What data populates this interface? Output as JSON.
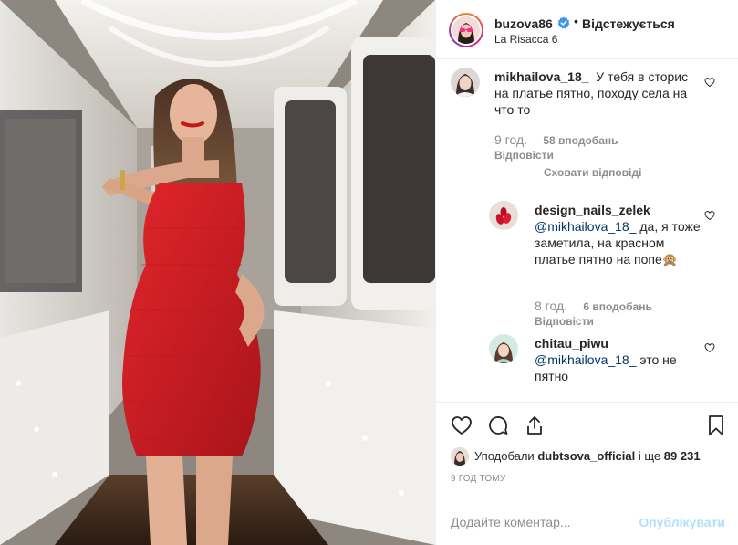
{
  "post": {
    "username": "buzova86",
    "separator": "•",
    "follow_status": "Відстежується",
    "location": "La Risacca 6"
  },
  "comments": [
    {
      "username": "mikhailova_18_",
      "text": "У тебя в сторис на платье пятно, походу села на что то",
      "time": "9 год.",
      "likes": "58 вподобань",
      "reply": "Відповісти",
      "hide_replies": "Сховати відповіді"
    },
    {
      "username": "design_nails_zelek",
      "mention": "@mikhailova_18_",
      "text": "да, я тоже заметила, на красном платье пятно на попе🙊",
      "time": "8 год.",
      "likes": "6 вподобань",
      "reply": "Відповісти"
    },
    {
      "username": "chitau_piwu",
      "mention": "@mikhailova_18_",
      "text": "это не пятно"
    }
  ],
  "actions": {
    "icons": [
      "heart-icon",
      "comment-icon",
      "share-icon",
      "bookmark-icon"
    ]
  },
  "likes": {
    "prefix": "Уподобали",
    "user": "dubtsova_official",
    "connector": "і ще",
    "count": "89 231"
  },
  "timestamp": "9 ГОД ТОМУ",
  "add_comment": {
    "placeholder": "Додайте коментар...",
    "post_label": "Опублікувати"
  },
  "colors": {
    "text": "#262626",
    "secondary": "#8e8e8e",
    "verified": "#3897f0",
    "post_disabled": "#b2dffc",
    "border": "#efefef"
  }
}
